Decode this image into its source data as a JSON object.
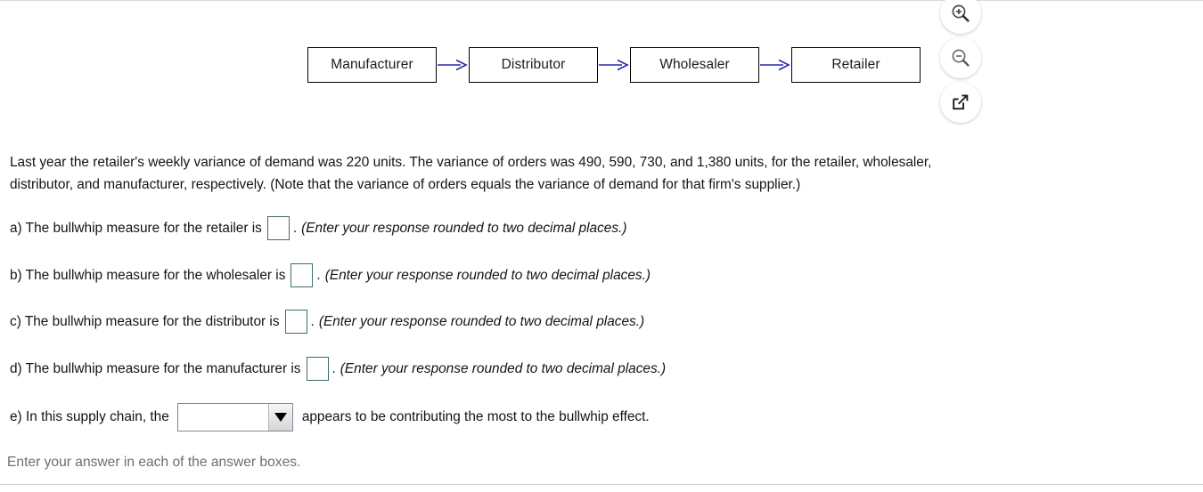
{
  "diagram": {
    "name": "supply-chain-flow",
    "nodes": [
      {
        "label": "Manufacturer"
      },
      {
        "label": "Distributor"
      },
      {
        "label": "Wholesaler"
      },
      {
        "label": "Retailer"
      }
    ],
    "arrow_color": "#2a2aaa"
  },
  "tools": [
    {
      "icon": "zoom-in-icon"
    },
    {
      "icon": "zoom-out-icon"
    },
    {
      "icon": "pop-out-icon"
    }
  ],
  "prompt": {
    "line1": "Last year the retailer's weekly variance of demand was 220 units. The variance of orders was 490, 590, 730, and 1,380 units, for the retailer, wholesaler,",
    "line2": "distributor, and manufacturer, respectively. (Note that the variance of orders equals the variance of demand for that firm's supplier.)"
  },
  "questions": [
    {
      "lead": "a) The bullwhip measure for the retailer is",
      "value": "",
      "period": ".",
      "tail": "(Enter your response rounded to two decimal places.)"
    },
    {
      "lead": "b) The bullwhip measure for the wholesaler is",
      "value": "",
      "period": ".",
      "tail": "(Enter your response rounded to two decimal places.)"
    },
    {
      "lead": "c) The bullwhip measure for the distributor is",
      "value": "",
      "period": ".",
      "tail": "(Enter your response rounded to two decimal places.)"
    },
    {
      "lead": "d) The bullwhip measure for the manufacturer is",
      "value": "",
      "period": ".",
      "tail": "(Enter your response rounded to two decimal places.)"
    }
  ],
  "question_e": {
    "lead": "e) In this supply chain, the",
    "select_value": "",
    "tail": "appears to be contributing the most to the bullwhip effect."
  },
  "footer": {
    "hint": "Enter your answer in each of the answer boxes."
  },
  "colors": {
    "arrow": "#2a2aaa",
    "answer_box_border": "#3f6b6b",
    "footer_text": "#6e6e6e",
    "rule": "#d8d8dd"
  }
}
